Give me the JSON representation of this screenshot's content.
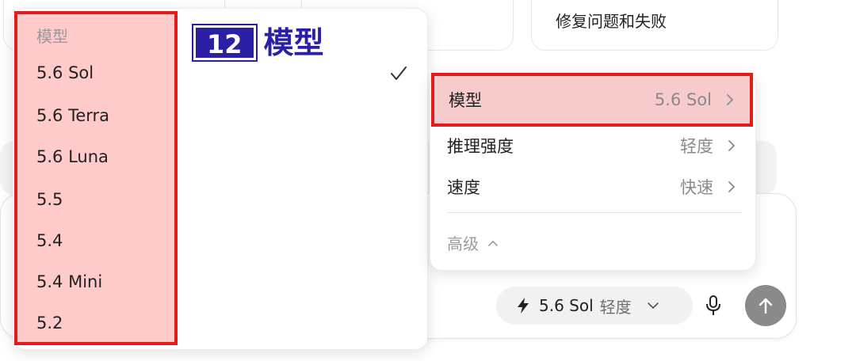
{
  "background": {
    "right_card_text": "修复问题和失败"
  },
  "model_list": {
    "header": "模型",
    "items": [
      "5.6 Sol",
      "5.6 Terra",
      "5.6 Luna",
      "5.5",
      "5.4",
      "5.4 Mini",
      "5.2"
    ],
    "selected_index": 0
  },
  "annotation": {
    "number": "12",
    "label": "模型"
  },
  "settings_menu": {
    "rows": [
      {
        "label": "模型",
        "value": "5.6 Sol"
      },
      {
        "label": "推理强度",
        "value": "轻度"
      },
      {
        "label": "速度",
        "value": "快速"
      }
    ],
    "advanced_label": "高级"
  },
  "composer": {
    "model_pill_model": "5.6 Sol",
    "model_pill_effort": "轻度"
  },
  "colors": {
    "highlight_border": "#e41b1b",
    "annotation": "#2a1fa5",
    "send_button": "#8a8a8a"
  },
  "icons": [
    "checkmark-icon",
    "chevron-right-icon",
    "chevron-up-icon",
    "bolt-icon",
    "chevron-down-icon",
    "microphone-icon",
    "arrow-up-icon"
  ]
}
